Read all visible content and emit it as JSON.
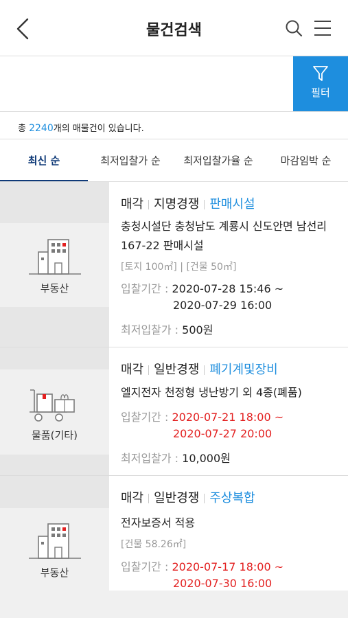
{
  "header": {
    "title": "물건검색"
  },
  "filter": {
    "label": "필터"
  },
  "count": {
    "prefix": "총 ",
    "number": "2240",
    "suffix": "개의 매물건이 있습니다."
  },
  "tabs": [
    {
      "label": "최신 순",
      "active": true
    },
    {
      "label": "최저입찰가 순",
      "active": false
    },
    {
      "label": "최저입찰가율 순",
      "active": false
    },
    {
      "label": "마감임박 순",
      "active": false
    }
  ],
  "items": [
    {
      "category": "부동산",
      "icon": "building-icon",
      "type1": "매각",
      "type2": "지명경쟁",
      "type3": "판매시설",
      "title_line1": "충청시설단 충청남도 계룡시 신도안면 남선리",
      "title_line2": "167-22 판매시설",
      "sub": "[토지 100㎡] | [건물 50㎡]",
      "period_label": "입찰기간 : ",
      "period_start": "2020-07-28 15:46 ~",
      "period_end": "2020-07-29 16:00",
      "period_highlight": false,
      "price_label": "최저입찰가 : ",
      "price": "500원"
    },
    {
      "category": "물품(기타)",
      "icon": "cart-boxes-icon",
      "type1": "매각",
      "type2": "일반경쟁",
      "type3": "폐기계및장비",
      "title_line1": "엘지전자 천정형 냉난방기 외 4종(폐품)",
      "period_label": "입찰기간 : ",
      "period_start": "2020-07-21 18:00 ~",
      "period_end": "2020-07-27 20:00",
      "period_highlight": true,
      "price_label": "최저입찰가 : ",
      "price": "10,000원"
    },
    {
      "category": "부동산",
      "icon": "building-icon",
      "type1": "매각",
      "type2": "일반경쟁",
      "type3": "주상복합",
      "title_line1": "전자보증서 적용",
      "sub": "[건물 58.26㎡]",
      "period_label": "입찰기간 : ",
      "period_start": "2020-07-17 18:00 ~",
      "period_end": "2020-07-30 16:00",
      "period_highlight": true
    }
  ],
  "colors": {
    "accent": "#1e8ede",
    "tab_active": "#0f3a78",
    "highlight_red": "#e32020"
  }
}
